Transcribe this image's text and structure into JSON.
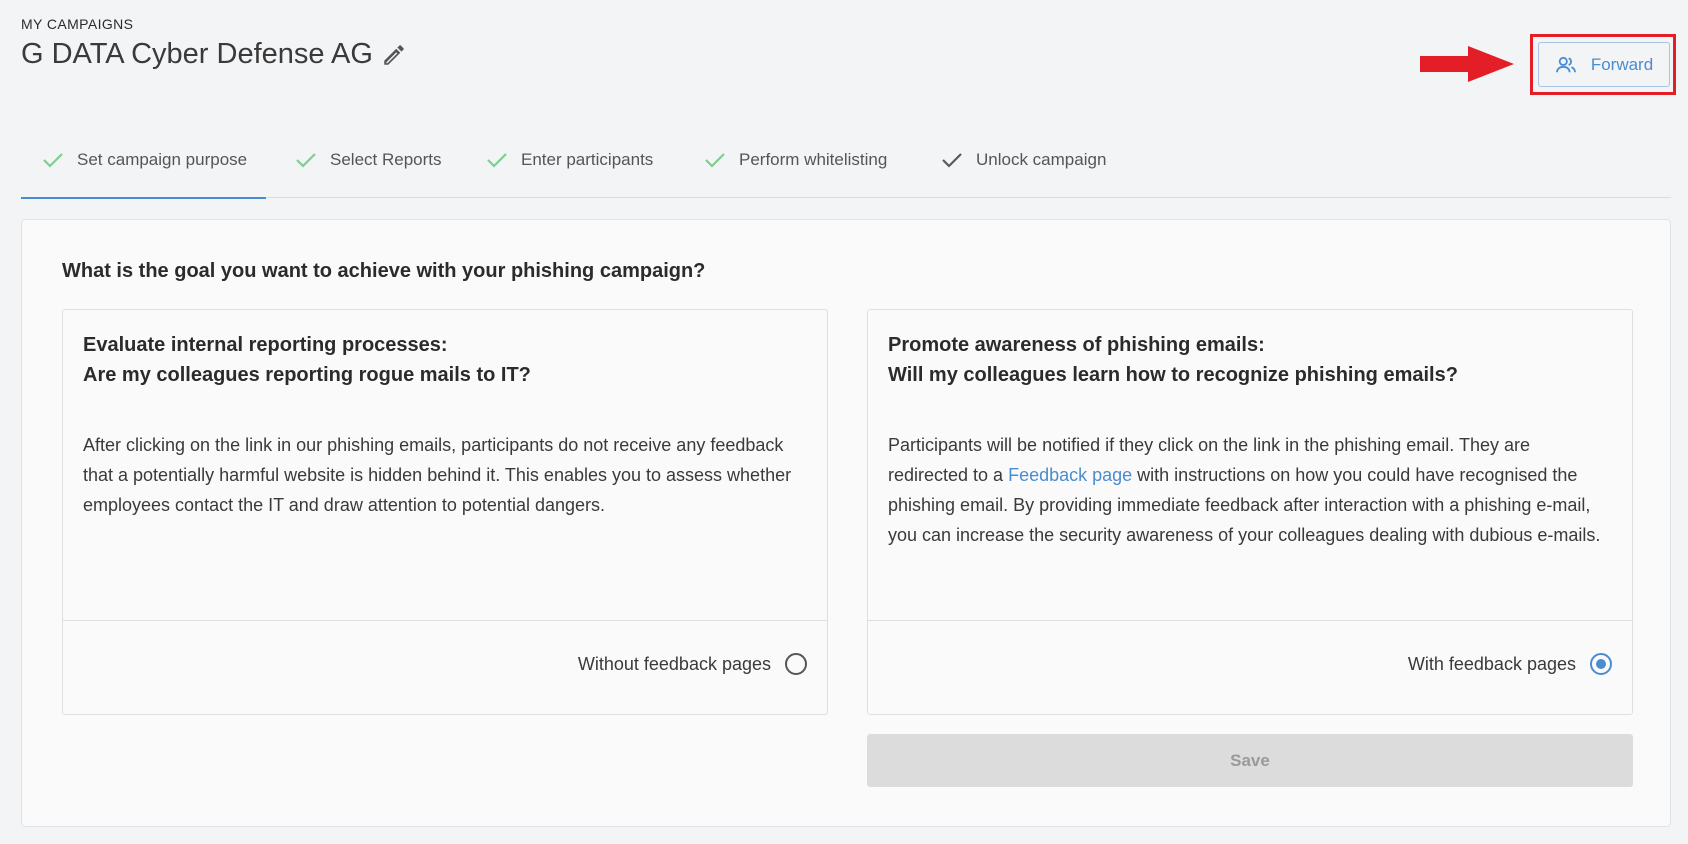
{
  "header": {
    "breadcrumb": "MY CAMPAIGNS",
    "title": "G DATA Cyber Defense AG",
    "forward_label": "Forward"
  },
  "steps": [
    {
      "label": "Set campaign purpose",
      "state": "done",
      "active": true
    },
    {
      "label": "Select Reports",
      "state": "done",
      "active": false
    },
    {
      "label": "Enter participants",
      "state": "done",
      "active": false
    },
    {
      "label": "Perform whitelisting",
      "state": "done",
      "active": false
    },
    {
      "label": "Unlock campaign",
      "state": "pending",
      "active": false
    }
  ],
  "main": {
    "question": "What is the goal you want to achieve with your phishing campaign?",
    "options": [
      {
        "heading_line1": "Evaluate internal reporting processes:",
        "heading_line2": "Are my colleagues reporting rogue mails to IT?",
        "body": "After clicking on the link in our phishing emails, participants do not receive any feedback that a potentially harmful website is hidden behind it. This enables you to assess whether employees contact the IT and draw attention to potential dangers.",
        "radio_label": "Without feedback pages",
        "selected": false
      },
      {
        "heading_line1": "Promote awareness of phishing emails:",
        "heading_line2": "Will my colleagues learn how to recognize phishing emails?",
        "body_before": "Participants will be notified if they click on the link in the phishing email. They are redirected to a ",
        "body_link": "Feedback page",
        "body_after": " with instructions on how you could have recognised the phishing email. By providing immediate feedback after interaction with a phishing e-mail, you can increase the security awareness of your colleagues dealing with dubious e-mails.",
        "radio_label": "With feedback pages",
        "selected": true
      }
    ],
    "save_label": "Save"
  },
  "colors": {
    "accent": "#4a8cd0",
    "check_done": "#7ccf8e",
    "check_pending": "#5a5a5a",
    "highlight": "#e41e26"
  }
}
